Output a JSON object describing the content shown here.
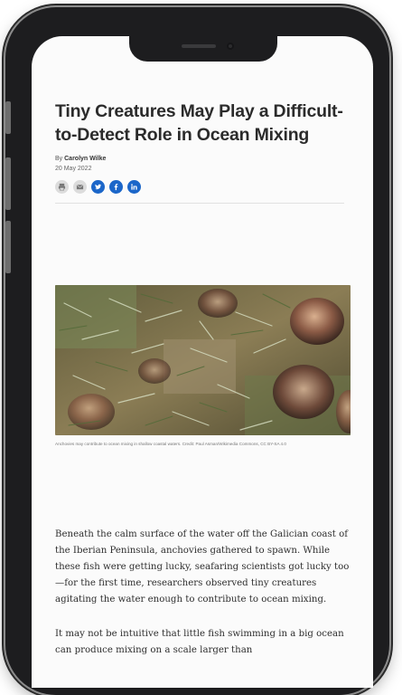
{
  "article": {
    "headline": "Tiny Creatures May Play a Difficult-to-Detect Role in Ocean Mixing",
    "byline_prefix": "By",
    "author": "Carolyn Wilke",
    "date": "20 May 2022",
    "share_icons": [
      "print-icon",
      "email-icon",
      "twitter-icon",
      "facebook-icon",
      "linkedin-icon"
    ],
    "image_caption": "Anchovies may contribute to ocean mixing in shallow coastal waters. Credit: Paul Asman/Wikimedia Commons, CC BY-SA 4.0",
    "paragraphs": [
      "Beneath the calm surface of the water off the Galician coast of the Iberian Peninsula, anchovies gathered to spawn. While these fish were getting lucky, seafaring scientists got lucky too—for the first time, researchers observed tiny creatures agitating the water enough to contribute to ocean mixing.",
      "It may not be intuitive that little fish swimming in a big ocean can produce mixing on a scale larger than"
    ]
  },
  "colors": {
    "share_blue": "#1b66c9",
    "share_grey": "#dcdcdc",
    "headline": "#2b2b2b",
    "phone_frame": "#1d1d1f"
  }
}
